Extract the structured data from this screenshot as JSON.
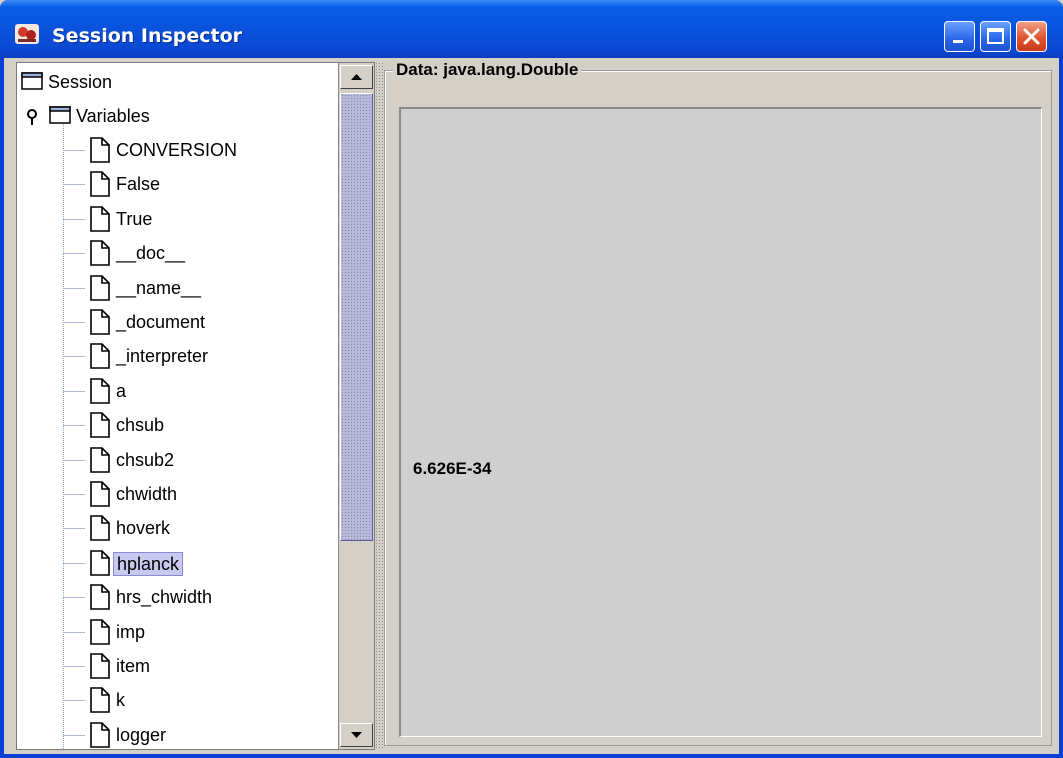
{
  "window": {
    "title": "Session Inspector"
  },
  "tree": {
    "root_label": "Session",
    "variables_label": "Variables",
    "items": [
      {
        "label": "CONVERSION"
      },
      {
        "label": "False"
      },
      {
        "label": "True"
      },
      {
        "label": "__doc__"
      },
      {
        "label": "__name__"
      },
      {
        "label": "_document"
      },
      {
        "label": "_interpreter"
      },
      {
        "label": "a"
      },
      {
        "label": "chsub"
      },
      {
        "label": "chsub2"
      },
      {
        "label": "chwidth"
      },
      {
        "label": "hoverk"
      },
      {
        "label": "hplanck",
        "selected": true
      },
      {
        "label": "hrs_chwidth"
      },
      {
        "label": "imp"
      },
      {
        "label": "item"
      },
      {
        "label": "k"
      },
      {
        "label": "logger"
      }
    ]
  },
  "data_panel": {
    "legend": "Data: java.lang.Double",
    "value": "6.626E-34"
  },
  "colors": {
    "titlebar": "#0a53dd",
    "selection": "#c8c8f0",
    "panel": "#d4d0c8"
  },
  "icons": {
    "app": "app-icon",
    "minimize": "minimize-icon",
    "maximize": "maximize-icon",
    "close": "close-icon",
    "folder": "folder-icon",
    "document": "document-icon",
    "expand": "expanded-handle-icon"
  }
}
